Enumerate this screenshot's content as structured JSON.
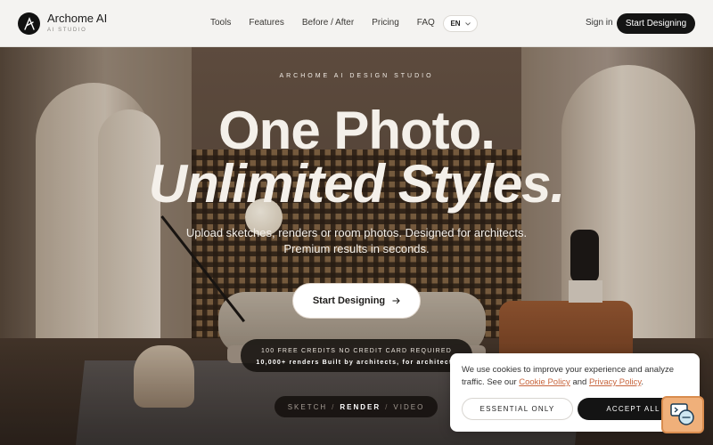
{
  "header": {
    "brand_name": "Archome AI",
    "brand_sub": "AI STUDIO",
    "nav": [
      "Tools",
      "Features",
      "Before / After",
      "Pricing",
      "FAQ"
    ],
    "language": "EN",
    "sign_in": "Sign in",
    "cta": "Start Designing"
  },
  "hero": {
    "eyebrow": "ARCHOME AI DESIGN STUDIO",
    "headline_1": "One Photo.",
    "headline_2": "Unlimited Styles.",
    "subtitle_1": "Upload sketches, renders or room photos. Designed for architects.",
    "subtitle_2": "Premium results in seconds.",
    "cta": "Start Designing",
    "credits_line_1": "100 FREE CREDITS NO CREDIT CARD REQUIRED",
    "credits_line_2": "10,000+ renders Built by architects, for architects",
    "modes": [
      "SKETCH",
      "RENDER",
      "VIDEO"
    ],
    "active_mode": "RENDER"
  },
  "cookie": {
    "text_before": "We use cookies to improve your experience and analyze traffic. See our ",
    "cookie_policy": "Cookie Policy",
    "and": " and ",
    "privacy_policy": "Privacy Policy",
    "period": ".",
    "essential_only": "ESSENTIAL ONLY",
    "accept_all": "ACCEPT ALL"
  },
  "colors": {
    "accent_link": "#c8663e",
    "dark": "#141414",
    "header_bg": "#f4f3f1"
  },
  "icons": {
    "logo": "archome-a-logo-icon",
    "chevron": "chevron-down-icon",
    "arrow": "arrow-right-icon",
    "chat": "chat-widget-icon"
  }
}
